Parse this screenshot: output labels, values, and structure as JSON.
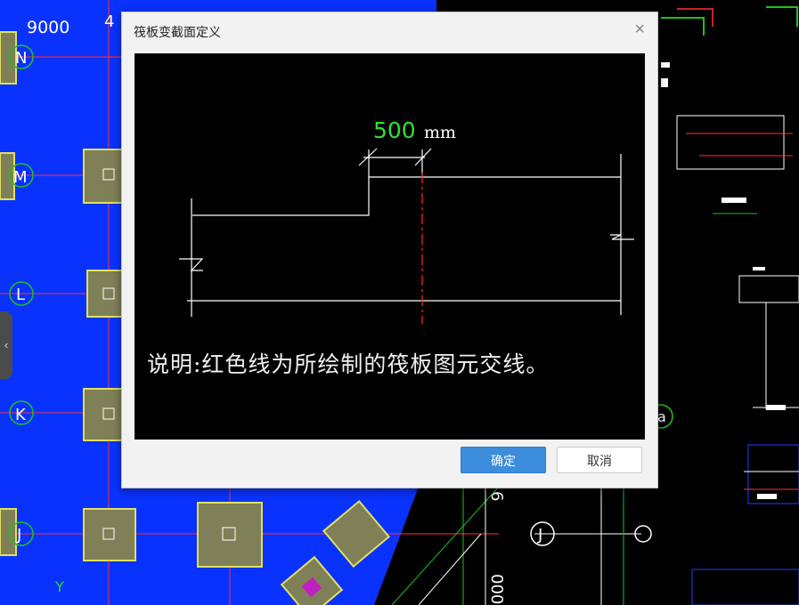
{
  "background": {
    "labels": {
      "top_dim": "9000",
      "axis_n": "N",
      "axis_m": "M",
      "axis_l": "L",
      "axis_k": "K",
      "axis_j": "J",
      "axis_j2": "J",
      "axis_top_4": "4",
      "axis_right_a": "a",
      "axis_y": "Y",
      "dim_6": "6",
      "dim_000": "000"
    },
    "colors": {
      "model_area": "#0a32ff",
      "grid_line": "#ff2020",
      "footing_outline": "#e0e060",
      "drawing_area": "#000000"
    }
  },
  "dialog": {
    "title": "筏板变截面定义",
    "close_icon": "close-icon",
    "preview": {
      "dimension_value": "500",
      "dimension_unit": "mm",
      "note": "说明:红色线为所绘制的筏板图元交线。",
      "colors": {
        "section_line": "#ffffff",
        "intersection_line": "#ff2020",
        "dimension_text": "#33e033"
      }
    },
    "buttons": {
      "ok": "确定",
      "cancel": "取消"
    }
  },
  "left_handle_icon": "chevron-left-icon"
}
